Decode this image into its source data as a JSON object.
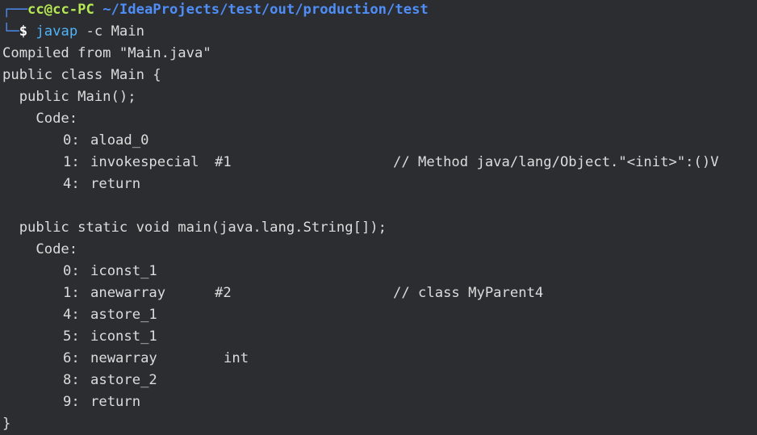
{
  "prompt": {
    "frame_top": "┌──",
    "frame_bottom": "└─",
    "user_host": "cc@cc-PC",
    "path": "~/IdeaProjects/test/out/production/test",
    "dollar": "$",
    "command": "javap",
    "args": "-c Main"
  },
  "output": {
    "compiled_from": "Compiled from \"Main.java\"",
    "class_decl": "public class Main {",
    "ctor_decl": "  public Main();",
    "ctor_code_label": "    Code:",
    "ctor_instructions": [
      {
        "index": "0:",
        "op": "aload_0",
        "arg": "",
        "comment": ""
      },
      {
        "index": "1:",
        "op": "invokespecial",
        "arg": "#1",
        "comment": "// Method java/lang/Object.\"<init>\":()V"
      },
      {
        "index": "4:",
        "op": "return",
        "arg": "",
        "comment": ""
      }
    ],
    "main_decl": "  public static void main(java.lang.String[]);",
    "main_code_label": "    Code:",
    "main_instructions": [
      {
        "index": "0:",
        "op": "iconst_1",
        "arg": "",
        "comment": ""
      },
      {
        "index": "1:",
        "op": "anewarray",
        "arg": "#2",
        "comment": "// class MyParent4"
      },
      {
        "index": "4:",
        "op": "astore_1",
        "arg": "",
        "comment": ""
      },
      {
        "index": "5:",
        "op": "iconst_1",
        "arg": "",
        "comment": ""
      },
      {
        "index": "6:",
        "op": "newarray",
        "arg": "int",
        "comment": ""
      },
      {
        "index": "8:",
        "op": "astore_2",
        "arg": "",
        "comment": ""
      },
      {
        "index": "9:",
        "op": "return",
        "arg": "",
        "comment": ""
      }
    ],
    "closing_brace": "}"
  },
  "colors": {
    "background": "#2b2d30",
    "prompt_user": "#b5e853",
    "prompt_path": "#4f8ef7",
    "command": "#4fb3f7",
    "text": "#dcdcdc"
  }
}
